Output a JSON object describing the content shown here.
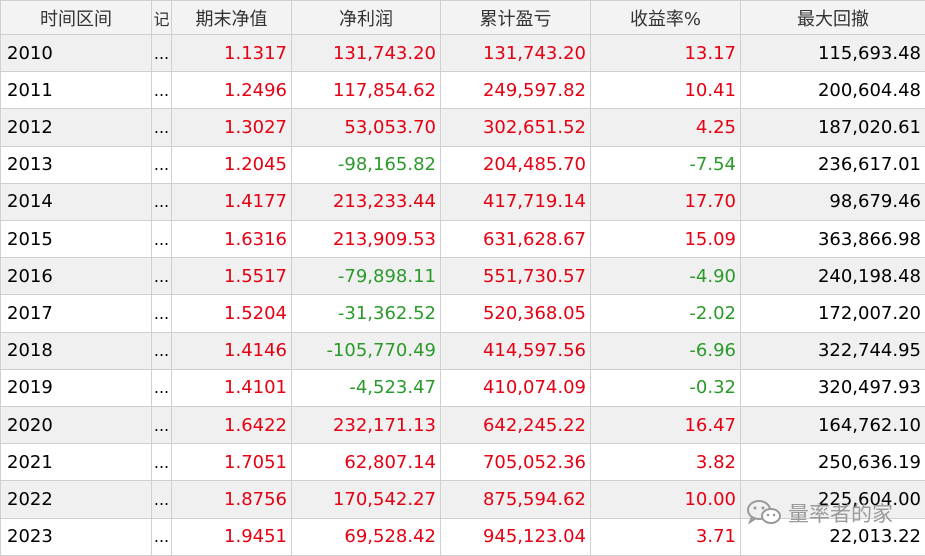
{
  "table": {
    "columns": [
      "时间区间",
      "记",
      "期末净值",
      "净利润",
      "累计盈亏",
      "收益率%",
      "最大回撤"
    ],
    "rows": [
      {
        "year": "2010",
        "stub": "...",
        "nav": "1.1317",
        "profit": "131,743.20",
        "cum": "131,743.20",
        "ret": "13.17",
        "dd": "115,693.48",
        "profit_sign": "pos",
        "ret_sign": "pos"
      },
      {
        "year": "2011",
        "stub": "...",
        "nav": "1.2496",
        "profit": "117,854.62",
        "cum": "249,597.82",
        "ret": "10.41",
        "dd": "200,604.48",
        "profit_sign": "pos",
        "ret_sign": "pos"
      },
      {
        "year": "2012",
        "stub": "...",
        "nav": "1.3027",
        "profit": "53,053.70",
        "cum": "302,651.52",
        "ret": "4.25",
        "dd": "187,020.61",
        "profit_sign": "pos",
        "ret_sign": "pos"
      },
      {
        "year": "2013",
        "stub": "...",
        "nav": "1.2045",
        "profit": "-98,165.82",
        "cum": "204,485.70",
        "ret": "-7.54",
        "dd": "236,617.01",
        "profit_sign": "neg",
        "ret_sign": "neg"
      },
      {
        "year": "2014",
        "stub": "...",
        "nav": "1.4177",
        "profit": "213,233.44",
        "cum": "417,719.14",
        "ret": "17.70",
        "dd": "98,679.46",
        "profit_sign": "pos",
        "ret_sign": "pos"
      },
      {
        "year": "2015",
        "stub": "...",
        "nav": "1.6316",
        "profit": "213,909.53",
        "cum": "631,628.67",
        "ret": "15.09",
        "dd": "363,866.98",
        "profit_sign": "pos",
        "ret_sign": "pos"
      },
      {
        "year": "2016",
        "stub": "...",
        "nav": "1.5517",
        "profit": "-79,898.11",
        "cum": "551,730.57",
        "ret": "-4.90",
        "dd": "240,198.48",
        "profit_sign": "neg",
        "ret_sign": "neg"
      },
      {
        "year": "2017",
        "stub": "...",
        "nav": "1.5204",
        "profit": "-31,362.52",
        "cum": "520,368.05",
        "ret": "-2.02",
        "dd": "172,007.20",
        "profit_sign": "neg",
        "ret_sign": "neg"
      },
      {
        "year": "2018",
        "stub": "...",
        "nav": "1.4146",
        "profit": "-105,770.49",
        "cum": "414,597.56",
        "ret": "-6.96",
        "dd": "322,744.95",
        "profit_sign": "neg",
        "ret_sign": "neg"
      },
      {
        "year": "2019",
        "stub": "...",
        "nav": "1.4101",
        "profit": "-4,523.47",
        "cum": "410,074.09",
        "ret": "-0.32",
        "dd": "320,497.93",
        "profit_sign": "neg",
        "ret_sign": "neg"
      },
      {
        "year": "2020",
        "stub": "...",
        "nav": "1.6422",
        "profit": "232,171.13",
        "cum": "642,245.22",
        "ret": "16.47",
        "dd": "164,762.10",
        "profit_sign": "pos",
        "ret_sign": "pos"
      },
      {
        "year": "2021",
        "stub": "...",
        "nav": "1.7051",
        "profit": "62,807.14",
        "cum": "705,052.36",
        "ret": "3.82",
        "dd": "250,636.19",
        "profit_sign": "pos",
        "ret_sign": "pos"
      },
      {
        "year": "2022",
        "stub": "...",
        "nav": "1.8756",
        "profit": "170,542.27",
        "cum": "875,594.62",
        "ret": "10.00",
        "dd": "225,604.00",
        "profit_sign": "pos",
        "ret_sign": "pos"
      },
      {
        "year": "2023",
        "stub": "...",
        "nav": "1.9451",
        "profit": "69,528.42",
        "cum": "945,123.04",
        "ret": "3.71",
        "dd": "22,013.22",
        "profit_sign": "pos",
        "ret_sign": "pos"
      }
    ]
  },
  "colors": {
    "positive": "#e60012",
    "negative": "#2a9a2a",
    "text": "#000000",
    "header_bg": "#f3f3f3",
    "alt_row_bg": "#f0f0f0",
    "grid": "#d0d0d0"
  },
  "watermark": {
    "text": "量率者的家",
    "icon": "wechat-icon"
  }
}
